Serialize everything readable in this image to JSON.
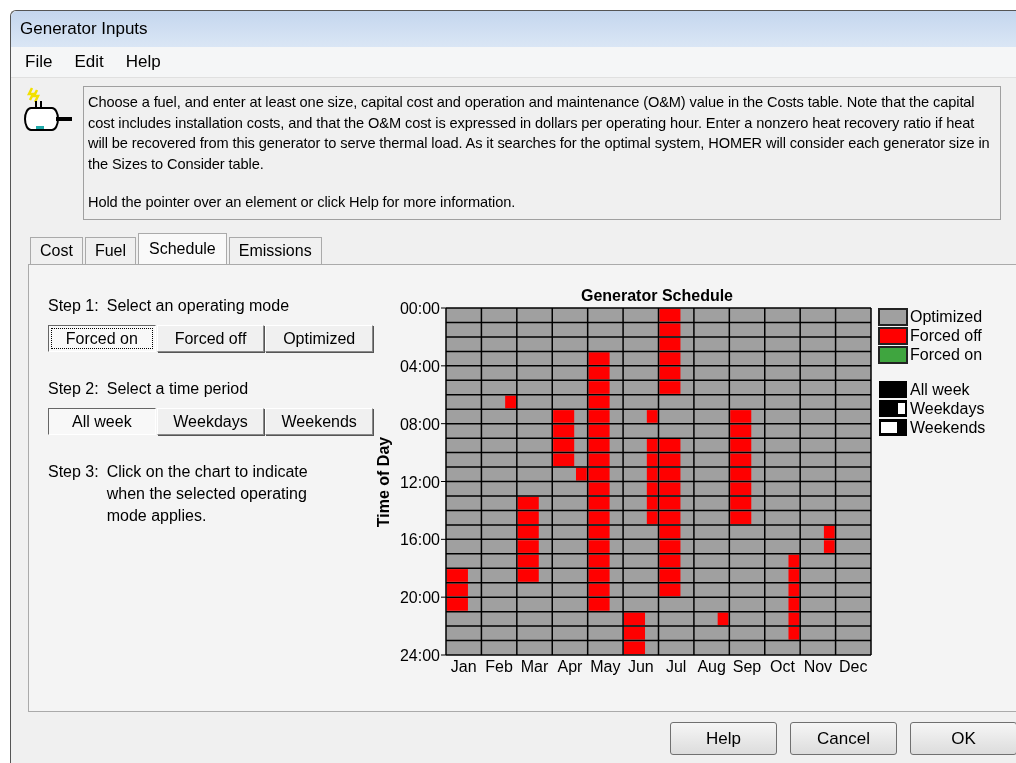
{
  "window": {
    "title": "Generator Inputs"
  },
  "menu": [
    {
      "label": "File"
    },
    {
      "label": "Edit"
    },
    {
      "label": "Help"
    }
  ],
  "info": {
    "paragraphs": [
      "Choose a fuel, and enter at least one size, capital cost and operation and maintenance (O&M) value in the Costs table. Note that the capital cost includes installation costs, and that the O&M cost is expressed in dollars per operating hour. Enter a nonzero heat recovery ratio if heat will be recovered from this generator to serve thermal load. As it searches for the optimal system, HOMER will consider each generator size in the Sizes to Consider table.",
      "Hold the pointer over an element or click Help for more information."
    ]
  },
  "tabs": [
    {
      "label": "Cost",
      "selected": false
    },
    {
      "label": "Fuel",
      "selected": false
    },
    {
      "label": "Schedule",
      "selected": true
    },
    {
      "label": "Emissions",
      "selected": false
    }
  ],
  "steps": [
    {
      "label": "Step 1:",
      "text": "Select an operating mode",
      "options": [
        {
          "label": "Forced on",
          "selected": true
        },
        {
          "label": "Forced off",
          "selected": false
        },
        {
          "label": "Optimized",
          "selected": false
        }
      ]
    },
    {
      "label": "Step 2:",
      "text": "Select a time period",
      "options": [
        {
          "label": "All week",
          "selected": true
        },
        {
          "label": "Weekdays",
          "selected": false
        },
        {
          "label": "Weekends",
          "selected": false
        }
      ]
    },
    {
      "label": "Step 3:",
      "text": "Click on the chart to indicate when the selected operating mode applies."
    }
  ],
  "schedule": {
    "title": "Generator Schedule",
    "axis_title": "Time of Day",
    "time_labels": [
      "00:00",
      "04:00",
      "08:00",
      "12:00",
      "16:00",
      "20:00",
      "24:00"
    ],
    "months": [
      {
        "label": "Jan",
        "hours": [
          {
            "kind": "optimized"
          },
          {
            "kind": "optimized"
          },
          {
            "kind": "optimized"
          },
          {
            "kind": "optimized"
          },
          {
            "kind": "optimized"
          },
          {
            "kind": "optimized"
          },
          {
            "kind": "optimized"
          },
          {
            "kind": "optimized"
          },
          {
            "kind": "optimized"
          },
          {
            "kind": "optimized"
          },
          {
            "kind": "optimized"
          },
          {
            "kind": "optimized"
          },
          {
            "kind": "optimized"
          },
          {
            "kind": "optimized"
          },
          {
            "kind": "optimized"
          },
          {
            "kind": "optimized"
          },
          {
            "kind": "optimized"
          },
          {
            "kind": "optimized"
          },
          {
            "kind": "weekdays"
          },
          {
            "kind": "weekdays"
          },
          {
            "kind": "weekdays"
          },
          {
            "kind": "optimized"
          },
          {
            "kind": "optimized"
          },
          {
            "kind": "optimized"
          }
        ]
      },
      {
        "label": "Feb",
        "hours": [
          {
            "kind": "optimized"
          },
          {
            "kind": "optimized"
          },
          {
            "kind": "optimized"
          },
          {
            "kind": "optimized"
          },
          {
            "kind": "optimized"
          },
          {
            "kind": "optimized"
          },
          {
            "kind": "weekends"
          },
          {
            "kind": "optimized"
          },
          {
            "kind": "optimized"
          },
          {
            "kind": "optimized"
          },
          {
            "kind": "optimized"
          },
          {
            "kind": "optimized"
          },
          {
            "kind": "optimized"
          },
          {
            "kind": "optimized"
          },
          {
            "kind": "optimized"
          },
          {
            "kind": "optimized"
          },
          {
            "kind": "optimized"
          },
          {
            "kind": "optimized"
          },
          {
            "kind": "optimized"
          },
          {
            "kind": "optimized"
          },
          {
            "kind": "optimized"
          },
          {
            "kind": "optimized"
          },
          {
            "kind": "optimized"
          },
          {
            "kind": "optimized"
          }
        ]
      },
      {
        "label": "Mar",
        "hours": [
          {
            "kind": "optimized"
          },
          {
            "kind": "optimized"
          },
          {
            "kind": "optimized"
          },
          {
            "kind": "optimized"
          },
          {
            "kind": "optimized"
          },
          {
            "kind": "optimized"
          },
          {
            "kind": "optimized"
          },
          {
            "kind": "optimized"
          },
          {
            "kind": "optimized"
          },
          {
            "kind": "optimized"
          },
          {
            "kind": "optimized"
          },
          {
            "kind": "optimized"
          },
          {
            "kind": "optimized"
          },
          {
            "kind": "weekdays"
          },
          {
            "kind": "weekdays"
          },
          {
            "kind": "weekdays"
          },
          {
            "kind": "weekdays"
          },
          {
            "kind": "weekdays"
          },
          {
            "kind": "weekdays"
          },
          {
            "kind": "optimized"
          },
          {
            "kind": "optimized"
          },
          {
            "kind": "optimized"
          },
          {
            "kind": "optimized"
          },
          {
            "kind": "optimized"
          }
        ]
      },
      {
        "label": "Apr",
        "hours": [
          {
            "kind": "optimized"
          },
          {
            "kind": "optimized"
          },
          {
            "kind": "optimized"
          },
          {
            "kind": "optimized"
          },
          {
            "kind": "optimized"
          },
          {
            "kind": "optimized"
          },
          {
            "kind": "optimized"
          },
          {
            "kind": "weekdays"
          },
          {
            "kind": "weekdays"
          },
          {
            "kind": "weekdays"
          },
          {
            "kind": "weekdays"
          },
          {
            "kind": "weekends"
          },
          {
            "kind": "optimized"
          },
          {
            "kind": "optimized"
          },
          {
            "kind": "optimized"
          },
          {
            "kind": "optimized"
          },
          {
            "kind": "optimized"
          },
          {
            "kind": "optimized"
          },
          {
            "kind": "optimized"
          },
          {
            "kind": "optimized"
          },
          {
            "kind": "optimized"
          },
          {
            "kind": "optimized"
          },
          {
            "kind": "optimized"
          },
          {
            "kind": "optimized"
          }
        ]
      },
      {
        "label": "May",
        "hours": [
          {
            "kind": "optimized"
          },
          {
            "kind": "optimized"
          },
          {
            "kind": "optimized"
          },
          {
            "kind": "weekdays"
          },
          {
            "kind": "weekdays"
          },
          {
            "kind": "weekdays"
          },
          {
            "kind": "weekdays"
          },
          {
            "kind": "weekdays"
          },
          {
            "kind": "weekdays"
          },
          {
            "kind": "weekdays"
          },
          {
            "kind": "weekdays"
          },
          {
            "kind": "weekdays"
          },
          {
            "kind": "weekdays"
          },
          {
            "kind": "weekdays"
          },
          {
            "kind": "weekdays"
          },
          {
            "kind": "weekdays"
          },
          {
            "kind": "weekdays"
          },
          {
            "kind": "weekdays"
          },
          {
            "kind": "weekdays"
          },
          {
            "kind": "weekdays"
          },
          {
            "kind": "weekdays"
          },
          {
            "kind": "optimized"
          },
          {
            "kind": "optimized"
          },
          {
            "kind": "optimized"
          }
        ]
      },
      {
        "label": "Jun",
        "hours": [
          {
            "kind": "optimized"
          },
          {
            "kind": "optimized"
          },
          {
            "kind": "optimized"
          },
          {
            "kind": "optimized"
          },
          {
            "kind": "optimized"
          },
          {
            "kind": "optimized"
          },
          {
            "kind": "optimized"
          },
          {
            "kind": "weekends"
          },
          {
            "kind": "optimized"
          },
          {
            "kind": "weekends"
          },
          {
            "kind": "weekends"
          },
          {
            "kind": "weekends"
          },
          {
            "kind": "weekends"
          },
          {
            "kind": "weekends"
          },
          {
            "kind": "weekends"
          },
          {
            "kind": "optimized"
          },
          {
            "kind": "optimized"
          },
          {
            "kind": "optimized"
          },
          {
            "kind": "optimized"
          },
          {
            "kind": "optimized"
          },
          {
            "kind": "optimized"
          },
          {
            "kind": "weekdays"
          },
          {
            "kind": "weekdays"
          },
          {
            "kind": "weekdays"
          }
        ]
      },
      {
        "label": "Jul",
        "hours": [
          {
            "kind": "weekdays"
          },
          {
            "kind": "weekdays"
          },
          {
            "kind": "weekdays"
          },
          {
            "kind": "weekdays"
          },
          {
            "kind": "weekdays"
          },
          {
            "kind": "weekdays"
          },
          {
            "kind": "optimized"
          },
          {
            "kind": "optimized"
          },
          {
            "kind": "optimized"
          },
          {
            "kind": "weekdays"
          },
          {
            "kind": "weekdays"
          },
          {
            "kind": "weekdays"
          },
          {
            "kind": "weekdays"
          },
          {
            "kind": "weekdays"
          },
          {
            "kind": "weekdays"
          },
          {
            "kind": "weekdays"
          },
          {
            "kind": "weekdays"
          },
          {
            "kind": "weekdays"
          },
          {
            "kind": "weekdays"
          },
          {
            "kind": "weekdays"
          },
          {
            "kind": "optimized"
          },
          {
            "kind": "optimized"
          },
          {
            "kind": "optimized"
          },
          {
            "kind": "optimized"
          }
        ]
      },
      {
        "label": "Aug",
        "hours": [
          {
            "kind": "optimized"
          },
          {
            "kind": "optimized"
          },
          {
            "kind": "optimized"
          },
          {
            "kind": "optimized"
          },
          {
            "kind": "optimized"
          },
          {
            "kind": "optimized"
          },
          {
            "kind": "optimized"
          },
          {
            "kind": "optimized"
          },
          {
            "kind": "optimized"
          },
          {
            "kind": "optimized"
          },
          {
            "kind": "optimized"
          },
          {
            "kind": "optimized"
          },
          {
            "kind": "optimized"
          },
          {
            "kind": "optimized"
          },
          {
            "kind": "optimized"
          },
          {
            "kind": "optimized"
          },
          {
            "kind": "optimized"
          },
          {
            "kind": "optimized"
          },
          {
            "kind": "optimized"
          },
          {
            "kind": "optimized"
          },
          {
            "kind": "optimized"
          },
          {
            "kind": "weekends"
          },
          {
            "kind": "optimized"
          },
          {
            "kind": "optimized"
          }
        ]
      },
      {
        "label": "Sep",
        "hours": [
          {
            "kind": "optimized"
          },
          {
            "kind": "optimized"
          },
          {
            "kind": "optimized"
          },
          {
            "kind": "optimized"
          },
          {
            "kind": "optimized"
          },
          {
            "kind": "optimized"
          },
          {
            "kind": "optimized"
          },
          {
            "kind": "weekdays"
          },
          {
            "kind": "weekdays"
          },
          {
            "kind": "weekdays"
          },
          {
            "kind": "weekdays"
          },
          {
            "kind": "weekdays"
          },
          {
            "kind": "weekdays"
          },
          {
            "kind": "weekdays"
          },
          {
            "kind": "weekdays"
          },
          {
            "kind": "optimized"
          },
          {
            "kind": "optimized"
          },
          {
            "kind": "optimized"
          },
          {
            "kind": "optimized"
          },
          {
            "kind": "optimized"
          },
          {
            "kind": "optimized"
          },
          {
            "kind": "optimized"
          },
          {
            "kind": "optimized"
          },
          {
            "kind": "optimized"
          }
        ]
      },
      {
        "label": "Oct",
        "hours": [
          {
            "kind": "optimized"
          },
          {
            "kind": "optimized"
          },
          {
            "kind": "optimized"
          },
          {
            "kind": "optimized"
          },
          {
            "kind": "optimized"
          },
          {
            "kind": "optimized"
          },
          {
            "kind": "optimized"
          },
          {
            "kind": "optimized"
          },
          {
            "kind": "optimized"
          },
          {
            "kind": "optimized"
          },
          {
            "kind": "optimized"
          },
          {
            "kind": "optimized"
          },
          {
            "kind": "optimized"
          },
          {
            "kind": "optimized"
          },
          {
            "kind": "optimized"
          },
          {
            "kind": "optimized"
          },
          {
            "kind": "optimized"
          },
          {
            "kind": "weekends"
          },
          {
            "kind": "weekends"
          },
          {
            "kind": "weekends"
          },
          {
            "kind": "weekends"
          },
          {
            "kind": "weekends"
          },
          {
            "kind": "weekends"
          },
          {
            "kind": "optimized"
          }
        ]
      },
      {
        "label": "Nov",
        "hours": [
          {
            "kind": "optimized"
          },
          {
            "kind": "optimized"
          },
          {
            "kind": "optimized"
          },
          {
            "kind": "optimized"
          },
          {
            "kind": "optimized"
          },
          {
            "kind": "optimized"
          },
          {
            "kind": "optimized"
          },
          {
            "kind": "optimized"
          },
          {
            "kind": "optimized"
          },
          {
            "kind": "optimized"
          },
          {
            "kind": "optimized"
          },
          {
            "kind": "optimized"
          },
          {
            "kind": "optimized"
          },
          {
            "kind": "optimized"
          },
          {
            "kind": "optimized"
          },
          {
            "kind": "weekends"
          },
          {
            "kind": "weekends"
          },
          {
            "kind": "optimized"
          },
          {
            "kind": "optimized"
          },
          {
            "kind": "optimized"
          },
          {
            "kind": "optimized"
          },
          {
            "kind": "optimized"
          },
          {
            "kind": "optimized"
          },
          {
            "kind": "optimized"
          }
        ]
      },
      {
        "label": "Dec",
        "hours": [
          {
            "kind": "optimized"
          },
          {
            "kind": "optimized"
          },
          {
            "kind": "optimized"
          },
          {
            "kind": "optimized"
          },
          {
            "kind": "optimized"
          },
          {
            "kind": "optimized"
          },
          {
            "kind": "optimized"
          },
          {
            "kind": "optimized"
          },
          {
            "kind": "optimized"
          },
          {
            "kind": "optimized"
          },
          {
            "kind": "optimized"
          },
          {
            "kind": "optimized"
          },
          {
            "kind": "optimized"
          },
          {
            "kind": "optimized"
          },
          {
            "kind": "optimized"
          },
          {
            "kind": "optimized"
          },
          {
            "kind": "optimized"
          },
          {
            "kind": "optimized"
          },
          {
            "kind": "optimized"
          },
          {
            "kind": "optimized"
          },
          {
            "kind": "optimized"
          },
          {
            "kind": "optimized"
          },
          {
            "kind": "optimized"
          },
          {
            "kind": "optimized"
          }
        ]
      }
    ],
    "legend_states": [
      {
        "label": "Optimized",
        "kind": "optimized",
        "color": "#a0a0a0"
      },
      {
        "label": "Forced off",
        "kind": "forced_off",
        "color": "#ff0000"
      },
      {
        "label": "Forced on",
        "kind": "forced_on",
        "color": "#3fa53f"
      }
    ],
    "legend_periods": [
      {
        "label": "All week",
        "kind": "all_week"
      },
      {
        "label": "Weekdays",
        "kind": "weekdays"
      },
      {
        "label": "Weekends",
        "kind": "weekends"
      }
    ]
  },
  "buttons": [
    {
      "label": "Help"
    },
    {
      "label": "Cancel"
    },
    {
      "label": "OK"
    }
  ]
}
